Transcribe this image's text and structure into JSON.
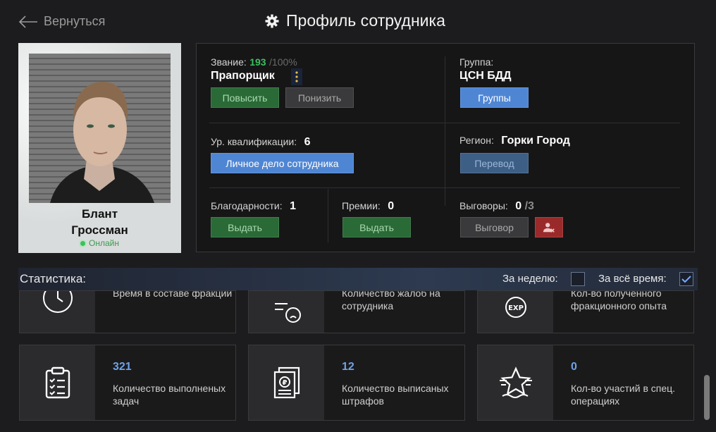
{
  "header": {
    "back_label": "Вернуться",
    "title": "Профиль сотрудника"
  },
  "profile": {
    "first_name": "Блант",
    "last_name": "Гроссман",
    "status": "Онлайн"
  },
  "rank": {
    "label": "Звание:",
    "points": "193",
    "max": "/100%",
    "name": "Прапорщик",
    "promote_label": "Повысить",
    "demote_label": "Понизить"
  },
  "group": {
    "label": "Группа:",
    "name": "ЦСН БДД",
    "button_label": "Группы"
  },
  "qualification": {
    "label": "Ур. квалификации:",
    "value": "6",
    "button_label": "Личное дело сотрудника"
  },
  "region": {
    "label": "Регион:",
    "value": "Горки Город",
    "button_label": "Перевод"
  },
  "thanks": {
    "label": "Благодарности:",
    "value": "1",
    "button_label": "Выдать"
  },
  "bonuses": {
    "label": "Премии:",
    "value": "0",
    "button_label": "Выдать"
  },
  "reprimands": {
    "label": "Выговоры:",
    "value": "0",
    "max": "/3",
    "button_label": "Выговор"
  },
  "stats": {
    "title": "Статистика:",
    "week_label": "За неделю:",
    "week_checked": false,
    "all_label": "За всё время:",
    "all_checked": true,
    "tiles_top": [
      {
        "desc": "Время в составе фракции",
        "icon": "clock-icon"
      },
      {
        "desc": "Количество жалоб на сотрудника",
        "icon": "complaint-icon"
      },
      {
        "desc": "Кол-во полученного фракционного опыта",
        "icon": "exp-icon"
      }
    ],
    "tiles": [
      {
        "value": "321",
        "desc": "Количество выполненых задач",
        "icon": "clipboard-icon"
      },
      {
        "value": "12",
        "desc": "Количество выписаных штрафов",
        "icon": "fine-document-icon"
      },
      {
        "value": "0",
        "desc": "Кол-во участий в спец. операциях",
        "icon": "star-icon"
      }
    ]
  },
  "colors": {
    "accent_blue": "#4f86d4",
    "green": "#2a6a36",
    "points_green": "#3cc060",
    "stat_blue": "#6ea3e8",
    "danger": "#9a2a2a"
  }
}
